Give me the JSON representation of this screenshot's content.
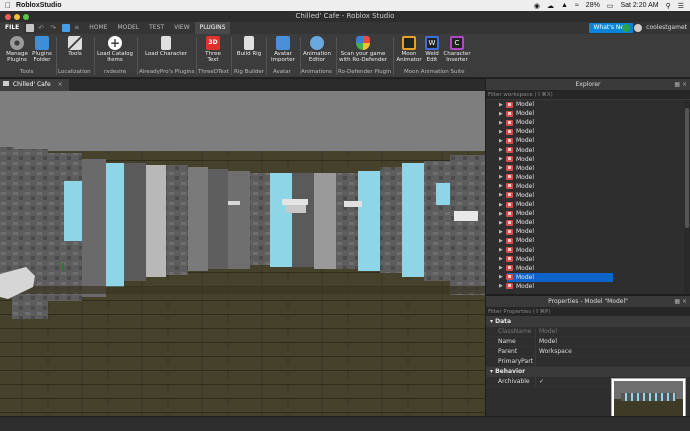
{
  "macos": {
    "app_name": "RobloxStudio",
    "battery": "28%",
    "clock": "Sat 2:20 AM"
  },
  "window": {
    "title": "Chilled' Cafe - Roblox Studio"
  },
  "ribbon_tabs": [
    "FILE",
    "HOME",
    "MODEL",
    "TEST",
    "VIEW",
    "PLUGINS"
  ],
  "active_tab": "PLUGINS",
  "whats_new": "What's New",
  "username": "coolestgamet",
  "ribbon": {
    "buttons": [
      {
        "label": "Manage Plugins",
        "icon": "gear-icon",
        "color": "#9a9a9a"
      },
      {
        "label": "Plugins Folder",
        "icon": "folder-icon",
        "color": "#3d8ed8"
      },
      {
        "label": "Tools",
        "icon": "tools-icon",
        "color": "#d0d0d0"
      },
      {
        "label": "Load Catalog Items",
        "icon": "plus-icon",
        "color": "#ffffff"
      },
      {
        "label": "Load Character",
        "icon": "character-icon",
        "color": "#e0e0e0"
      },
      {
        "label": "Three Text",
        "icon": "3d-text-icon",
        "color": "#e0322b"
      },
      {
        "label": "Build Rig",
        "icon": "rig-icon",
        "color": "#e0e0e0"
      },
      {
        "label": "Avatar Importer",
        "icon": "avatar-importer-icon",
        "color": "#4a90d9"
      },
      {
        "label": "Animation Editor",
        "icon": "animation-editor-icon",
        "color": "#6aa9e0"
      },
      {
        "label": "Scan your game with Ro-Defender",
        "icon": "shield-icon",
        "color": "#e84b3c"
      },
      {
        "label": "Moon Animator",
        "icon": "moon-icon",
        "color": "#e8a02a"
      },
      {
        "label": "Weld Edit",
        "icon": "weld-icon",
        "color": "#3e6ed8"
      },
      {
        "label": "Character Inserter",
        "icon": "character-inserter-icon",
        "color": "#b048c8"
      }
    ],
    "groups": [
      "Tools",
      "Localization",
      "rxdesire",
      "AlreadyPro's Plugins",
      "ThreeDText",
      "Rig Builder",
      "Avatar",
      "Animations",
      "Ro-Defender Plugin",
      "Moon Animation Suite"
    ]
  },
  "viewport_tab": "Chilled' Cafe",
  "explorer": {
    "title": "Explorer",
    "filter_placeholder": "Filter workspace (⇧⌘X)",
    "items": [
      "Model",
      "Model",
      "Model",
      "Model",
      "Model",
      "Model",
      "Model",
      "Model",
      "Model",
      "Model",
      "Model",
      "Model",
      "Model",
      "Model",
      "Model",
      "Model",
      "Model",
      "Model",
      "Model",
      "Model",
      "Model"
    ],
    "selected_index": 19
  },
  "properties": {
    "title": "Properties - Model \"Model\"",
    "filter_placeholder": "Filter Properties (⇧⌘P)",
    "sections": {
      "data": "Data",
      "behavior": "Behavior"
    },
    "rows": [
      {
        "key": "ClassName",
        "value": "Model"
      },
      {
        "key": "Name",
        "value": "Model"
      },
      {
        "key": "Parent",
        "value": "Workspace"
      },
      {
        "key": "PrimaryPart",
        "value": ""
      }
    ],
    "archivable_label": "Archivable",
    "archivable_check": "✓"
  }
}
